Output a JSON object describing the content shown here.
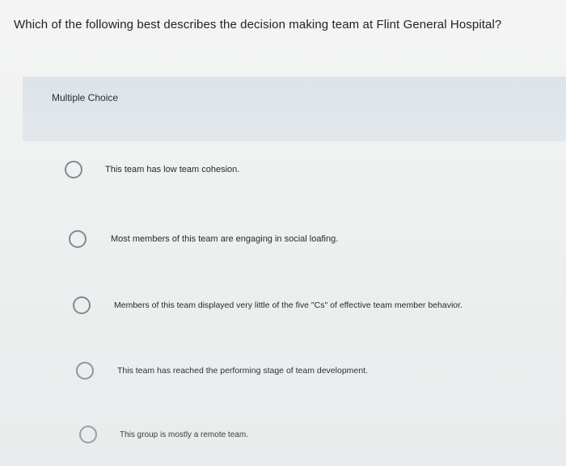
{
  "question": {
    "text": "Which of the following best describes the decision making team at Flint General Hospital?"
  },
  "question_type": {
    "label": "Multiple Choice"
  },
  "options": [
    {
      "text": "This team has low team cohesion."
    },
    {
      "text": "Most members of this team are engaging in social loafing."
    },
    {
      "text": "Members of this team displayed very little of the five \"Cs\" of effective team member behavior."
    },
    {
      "text": "This team has reached the performing stage of team development."
    },
    {
      "text": "This group is mostly a remote team."
    }
  ]
}
